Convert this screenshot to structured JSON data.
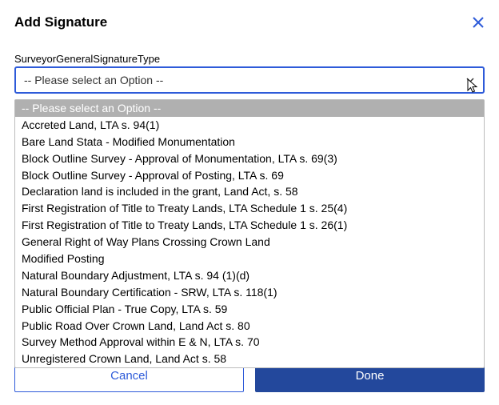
{
  "dialog": {
    "title": "Add Signature"
  },
  "field": {
    "label": "SurveyorGeneralSignatureType",
    "selected_value": "-- Please select an Option --"
  },
  "dropdown": {
    "options": [
      "-- Please select an Option --",
      "Accreted Land, LTA s. 94(1)",
      "Bare Land Stata - Modified Monumentation",
      "Block Outline Survey - Approval of Monumentation, LTA s. 69(3)",
      "Block Outline Survey - Approval of Posting, LTA s. 69",
      "Declaration land is included in the grant, Land Act, s. 58",
      "First Registration of Title to Treaty Lands, LTA Schedule 1 s. 25(4)",
      "First Registration of Title to Treaty Lands, LTA Schedule 1 s. 26(1)",
      "General Right of Way Plans Crossing Crown Land",
      "Modified Posting",
      "Natural Boundary Adjustment, LTA s. 94 (1)(d)",
      "Natural Boundary Certification - SRW, LTA s. 118(1)",
      "Public Official Plan - True Copy, LTA s. 59",
      "Public Road Over Crown Land, Land Act s. 80",
      "Survey Method Approval within E & N, LTA s. 70",
      "Unregistered Crown Land, Land Act s. 58"
    ]
  },
  "buttons": {
    "cancel": "Cancel",
    "done": "Done"
  }
}
